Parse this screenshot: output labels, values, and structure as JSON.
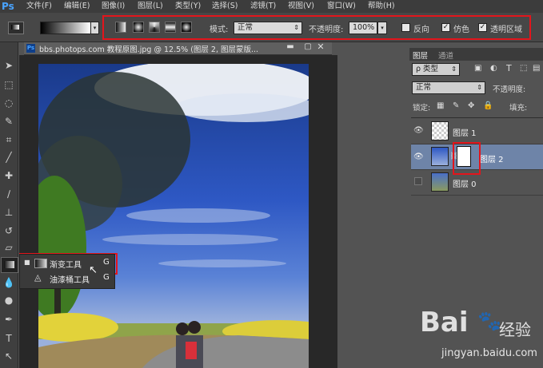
{
  "app": {
    "logo": "Ps"
  },
  "menu": [
    "文件(F)",
    "编辑(E)",
    "图像(I)",
    "图层(L)",
    "类型(Y)",
    "选择(S)",
    "滤镜(T)",
    "视图(V)",
    "窗口(W)",
    "帮助(H)"
  ],
  "options": {
    "mode_label": "模式:",
    "mode_value": "正常",
    "opacity_label": "不透明度:",
    "opacity_value": "100%",
    "reverse_label": "反向",
    "dither_label": "仿色",
    "transparency_label": "透明区域",
    "reverse_checked": false,
    "dither_checked": true,
    "transparency_checked": true
  },
  "document": {
    "tab_title": "bbs.photops.com 教程原图.jpg @ 12.5% (图层 2, 图层蒙版..."
  },
  "tool_flyout": {
    "items": [
      {
        "label": "渐变工具",
        "shortcut": "G",
        "selected": true
      },
      {
        "label": "油漆桶工具",
        "shortcut": "G",
        "selected": false
      }
    ]
  },
  "layers_panel": {
    "tabs": [
      "图层",
      "通道"
    ],
    "kind_filter": "ρ 类型",
    "blend_mode": "正常",
    "opacity_label": "不透明度:",
    "lock_label": "锁定:",
    "fill_label": "填充:",
    "layers": [
      {
        "name": "图层 1",
        "visible": true,
        "selected": false
      },
      {
        "name": "图层 2",
        "visible": true,
        "selected": true
      },
      {
        "name": "图层 0",
        "visible": false,
        "selected": false
      }
    ]
  },
  "watermark": {
    "brand": "Bai",
    "brand2": "经验",
    "url": "jingyan.baidu.com"
  },
  "colors": {
    "accent_red": "#e3151c",
    "selected_layer": "#6e84a8",
    "ps_blue": "#49a3ff"
  }
}
